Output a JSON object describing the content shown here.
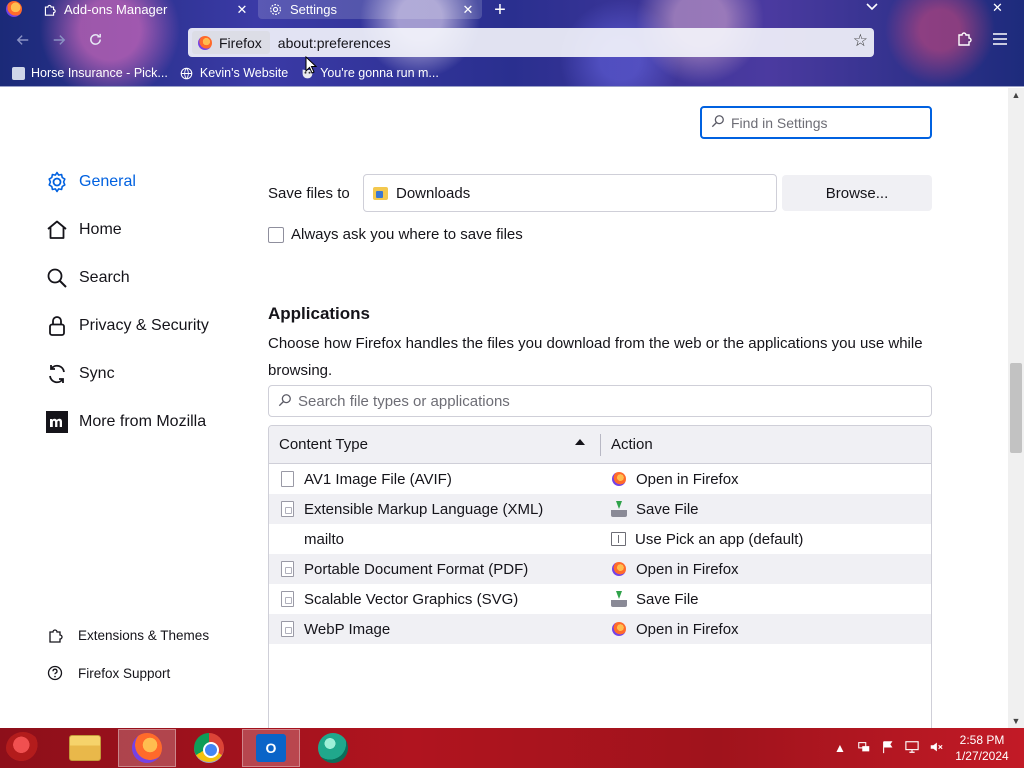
{
  "tabs": [
    {
      "label": "Add-ons Manager",
      "icon": "puzzle-icon",
      "active": false
    },
    {
      "label": "Settings",
      "icon": "gear-icon",
      "active": true
    }
  ],
  "urlbar": {
    "identity_label": "Firefox",
    "url": "about:preferences"
  },
  "bookmarks": [
    {
      "label": "Horse Insurance - Pick...",
      "icon": "page-icon"
    },
    {
      "label": "Kevin's Website",
      "icon": "globe-icon"
    },
    {
      "label": "You're gonna run m...",
      "icon": "mask-icon"
    }
  ],
  "search": {
    "placeholder": "Find in Settings"
  },
  "sidebar": {
    "categories": [
      {
        "label": "General",
        "icon": "gear-icon",
        "selected": true
      },
      {
        "label": "Home",
        "icon": "home-icon"
      },
      {
        "label": "Search",
        "icon": "search-icon"
      },
      {
        "label": "Privacy & Security",
        "icon": "lock-icon"
      },
      {
        "label": "Sync",
        "icon": "sync-icon"
      },
      {
        "label": "More from Mozilla",
        "icon": "mozilla-icon"
      }
    ],
    "footer": [
      {
        "label": "Extensions & Themes",
        "icon": "puzzle-icon"
      },
      {
        "label": "Firefox Support",
        "icon": "help-icon"
      }
    ]
  },
  "downloads": {
    "save_label": "Save files to",
    "folder": "Downloads",
    "browse_label": "Browse...",
    "always_ask_label": "Always ask you where to save files",
    "always_ask_checked": false
  },
  "applications": {
    "title": "Applications",
    "description": "Choose how Firefox handles the files you download from the web or the applications you use while browsing.",
    "search_placeholder": "Search file types or applications",
    "columns": {
      "content_type": "Content Type",
      "action": "Action"
    },
    "rows": [
      {
        "type": "AV1 Image File (AVIF)",
        "file_icon": "file-icon",
        "action": "Open in Firefox",
        "action_icon": "firefox-icon"
      },
      {
        "type": "Extensible Markup Language (XML)",
        "file_icon": "document-icon",
        "action": "Save File",
        "action_icon": "save-icon"
      },
      {
        "type": "mailto",
        "file_icon": "none",
        "action": "Use Pick an app (default)",
        "action_icon": "app-icon"
      },
      {
        "type": "Portable Document Format (PDF)",
        "file_icon": "document-icon",
        "action": "Open in Firefox",
        "action_icon": "firefox-icon"
      },
      {
        "type": "Scalable Vector Graphics (SVG)",
        "file_icon": "document-icon",
        "action": "Save File",
        "action_icon": "save-icon"
      },
      {
        "type": "WebP Image",
        "file_icon": "document-icon",
        "action": "Open in Firefox",
        "action_icon": "firefox-icon"
      }
    ]
  },
  "taskbar": {
    "apps": [
      "File Explorer",
      "Firefox",
      "Chrome",
      "Outlook",
      "Globe App"
    ],
    "clock": {
      "time": "2:58 PM",
      "date": "1/27/2024"
    }
  }
}
